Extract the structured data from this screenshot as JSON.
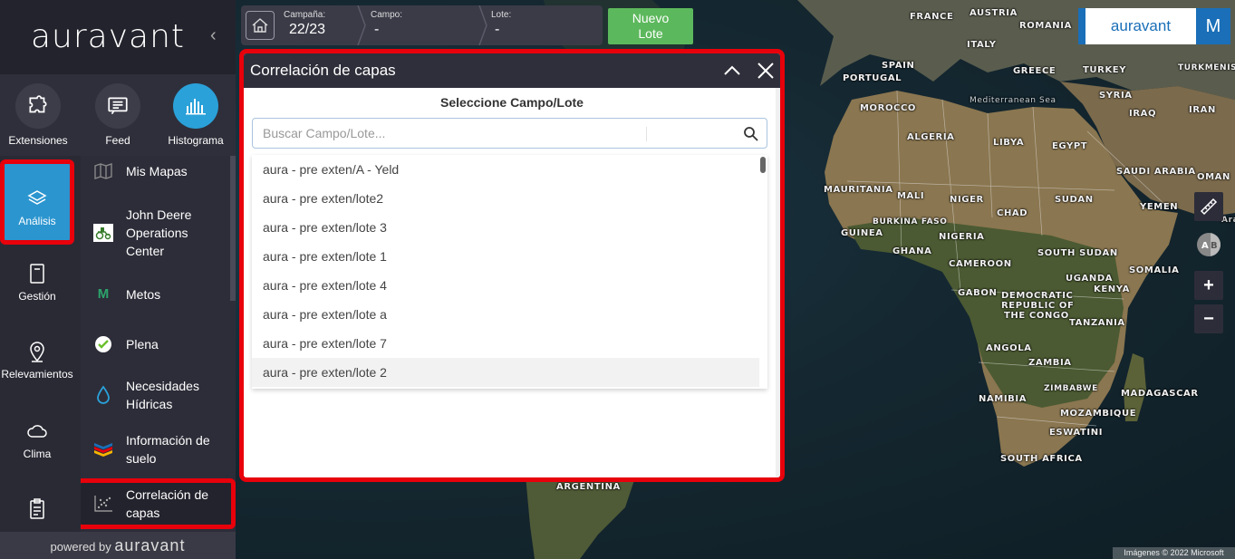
{
  "sidebar": {
    "brand": "auravant",
    "collapse_glyph": "‹",
    "tools": [
      {
        "label": "Extensiones",
        "icon": "puzzle-icon"
      },
      {
        "label": "Feed",
        "icon": "feed-icon"
      },
      {
        "label": "Histograma",
        "icon": "histogram-icon"
      }
    ],
    "nav": [
      {
        "label": "Análisis",
        "icon": "layers-icon"
      },
      {
        "label": "Gestión",
        "icon": "notebook-icon"
      },
      {
        "label": "Relevamientos",
        "icon": "location-pin-icon"
      },
      {
        "label": "Clima",
        "icon": "cloud-icon"
      },
      {
        "label": "",
        "icon": "clipboard-icon"
      }
    ],
    "sub_items": [
      {
        "label": "Mis Mapas",
        "icon": "map-icon"
      },
      {
        "label": "John Deere Operations Center",
        "icon": "john-deere-icon"
      },
      {
        "label": "Metos",
        "icon": "metos-icon",
        "glyph": "M"
      },
      {
        "label": "Plena",
        "icon": "plena-icon"
      },
      {
        "label": "Necesidades Hídricas",
        "icon": "water-drop-icon"
      },
      {
        "label": "Información de suelo",
        "icon": "soil-layers-icon"
      },
      {
        "label": "Correlación de capas",
        "icon": "scatter-plot-icon"
      }
    ],
    "powered_prefix": "powered by",
    "powered_brand": "auravant"
  },
  "selector": {
    "campana_label": "Campaña:",
    "campana_value": "22/23",
    "campo_label": "Campo:",
    "campo_value": "-",
    "lote_label": "Lote:",
    "lote_value": "-",
    "new_lote_line1": "Nuevo",
    "new_lote_line2": "Lote"
  },
  "header_right": {
    "brand": "auravant",
    "avatar_initial": "M"
  },
  "dialog": {
    "title": "Correlación de capas",
    "subtitle": "Seleccione Campo/Lote",
    "search_placeholder": "Buscar Campo/Lote...",
    "results": [
      "aura - pre exten/A - Yeld",
      "aura - pre exten/lote2",
      "aura - pre exten/lote 3",
      "aura - pre exten/lote 1",
      "aura - pre exten/lote 4",
      "aura - pre exten/lote a",
      "aura - pre exten/lote 7",
      "aura - pre exten/lote 2"
    ]
  },
  "map": {
    "labels": [
      "FRANCE",
      "AUSTRIA",
      "ROMANIA",
      "ITALY",
      "SPAIN",
      "PORTUGAL",
      "GREECE",
      "TURKEY",
      "TURKMENISTAN",
      "Mediterranean Sea",
      "SYRIA",
      "MOROCCO",
      "IRAQ",
      "IRAN",
      "ALGERIA",
      "LIBYA",
      "EGYPT",
      "SAUDI ARABIA",
      "OMAN",
      "MAURITANIA",
      "MALI",
      "NIGER",
      "CHAD",
      "SUDAN",
      "YEMEN",
      "BURKINA FASO",
      "GUINEA",
      "NIGERIA",
      "GHANA",
      "SOUTH SUDAN",
      "CAMEROON",
      "SOMALIA",
      "UGANDA",
      "KENYA",
      "GABON",
      "DEMOCRATIC",
      "REPUBLIC OF",
      "THE CONGO",
      "TANZANIA",
      "ANGOLA",
      "ZAMBIA",
      "ZIMBABWE",
      "NAMIBIA",
      "MADAGASCAR",
      "MOZAMBIQUE",
      "ESWATINI",
      "SOUTH AFRICA",
      "ARGENTINA",
      "Arabia"
    ],
    "controls": {
      "zoom_in": "+",
      "zoom_out": "−",
      "compare": "A B"
    },
    "attribution": "Imágenes © 2022 Microsoft"
  },
  "colors": {
    "accent": "#2b95cf",
    "highlight": "#e8000b",
    "green": "#5cb85c",
    "brand_blue": "#1a6fb8",
    "panel_dark": "#2a2a35"
  }
}
